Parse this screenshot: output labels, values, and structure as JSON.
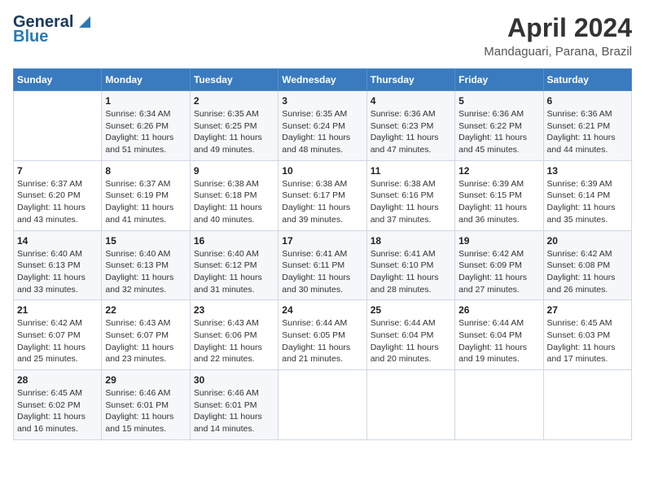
{
  "header": {
    "logo_line1": "General",
    "logo_line2": "Blue",
    "month_title": "April 2024",
    "location": "Mandaguari, Parana, Brazil"
  },
  "calendar": {
    "days_of_week": [
      "Sunday",
      "Monday",
      "Tuesday",
      "Wednesday",
      "Thursday",
      "Friday",
      "Saturday"
    ],
    "weeks": [
      [
        {
          "day": "",
          "info": ""
        },
        {
          "day": "1",
          "info": "Sunrise: 6:34 AM\nSunset: 6:26 PM\nDaylight: 11 hours\nand 51 minutes."
        },
        {
          "day": "2",
          "info": "Sunrise: 6:35 AM\nSunset: 6:25 PM\nDaylight: 11 hours\nand 49 minutes."
        },
        {
          "day": "3",
          "info": "Sunrise: 6:35 AM\nSunset: 6:24 PM\nDaylight: 11 hours\nand 48 minutes."
        },
        {
          "day": "4",
          "info": "Sunrise: 6:36 AM\nSunset: 6:23 PM\nDaylight: 11 hours\nand 47 minutes."
        },
        {
          "day": "5",
          "info": "Sunrise: 6:36 AM\nSunset: 6:22 PM\nDaylight: 11 hours\nand 45 minutes."
        },
        {
          "day": "6",
          "info": "Sunrise: 6:36 AM\nSunset: 6:21 PM\nDaylight: 11 hours\nand 44 minutes."
        }
      ],
      [
        {
          "day": "7",
          "info": "Sunrise: 6:37 AM\nSunset: 6:20 PM\nDaylight: 11 hours\nand 43 minutes."
        },
        {
          "day": "8",
          "info": "Sunrise: 6:37 AM\nSunset: 6:19 PM\nDaylight: 11 hours\nand 41 minutes."
        },
        {
          "day": "9",
          "info": "Sunrise: 6:38 AM\nSunset: 6:18 PM\nDaylight: 11 hours\nand 40 minutes."
        },
        {
          "day": "10",
          "info": "Sunrise: 6:38 AM\nSunset: 6:17 PM\nDaylight: 11 hours\nand 39 minutes."
        },
        {
          "day": "11",
          "info": "Sunrise: 6:38 AM\nSunset: 6:16 PM\nDaylight: 11 hours\nand 37 minutes."
        },
        {
          "day": "12",
          "info": "Sunrise: 6:39 AM\nSunset: 6:15 PM\nDaylight: 11 hours\nand 36 minutes."
        },
        {
          "day": "13",
          "info": "Sunrise: 6:39 AM\nSunset: 6:14 PM\nDaylight: 11 hours\nand 35 minutes."
        }
      ],
      [
        {
          "day": "14",
          "info": "Sunrise: 6:40 AM\nSunset: 6:13 PM\nDaylight: 11 hours\nand 33 minutes."
        },
        {
          "day": "15",
          "info": "Sunrise: 6:40 AM\nSunset: 6:13 PM\nDaylight: 11 hours\nand 32 minutes."
        },
        {
          "day": "16",
          "info": "Sunrise: 6:40 AM\nSunset: 6:12 PM\nDaylight: 11 hours\nand 31 minutes."
        },
        {
          "day": "17",
          "info": "Sunrise: 6:41 AM\nSunset: 6:11 PM\nDaylight: 11 hours\nand 30 minutes."
        },
        {
          "day": "18",
          "info": "Sunrise: 6:41 AM\nSunset: 6:10 PM\nDaylight: 11 hours\nand 28 minutes."
        },
        {
          "day": "19",
          "info": "Sunrise: 6:42 AM\nSunset: 6:09 PM\nDaylight: 11 hours\nand 27 minutes."
        },
        {
          "day": "20",
          "info": "Sunrise: 6:42 AM\nSunset: 6:08 PM\nDaylight: 11 hours\nand 26 minutes."
        }
      ],
      [
        {
          "day": "21",
          "info": "Sunrise: 6:42 AM\nSunset: 6:07 PM\nDaylight: 11 hours\nand 25 minutes."
        },
        {
          "day": "22",
          "info": "Sunrise: 6:43 AM\nSunset: 6:07 PM\nDaylight: 11 hours\nand 23 minutes."
        },
        {
          "day": "23",
          "info": "Sunrise: 6:43 AM\nSunset: 6:06 PM\nDaylight: 11 hours\nand 22 minutes."
        },
        {
          "day": "24",
          "info": "Sunrise: 6:44 AM\nSunset: 6:05 PM\nDaylight: 11 hours\nand 21 minutes."
        },
        {
          "day": "25",
          "info": "Sunrise: 6:44 AM\nSunset: 6:04 PM\nDaylight: 11 hours\nand 20 minutes."
        },
        {
          "day": "26",
          "info": "Sunrise: 6:44 AM\nSunset: 6:04 PM\nDaylight: 11 hours\nand 19 minutes."
        },
        {
          "day": "27",
          "info": "Sunrise: 6:45 AM\nSunset: 6:03 PM\nDaylight: 11 hours\nand 17 minutes."
        }
      ],
      [
        {
          "day": "28",
          "info": "Sunrise: 6:45 AM\nSunset: 6:02 PM\nDaylight: 11 hours\nand 16 minutes."
        },
        {
          "day": "29",
          "info": "Sunrise: 6:46 AM\nSunset: 6:01 PM\nDaylight: 11 hours\nand 15 minutes."
        },
        {
          "day": "30",
          "info": "Sunrise: 6:46 AM\nSunset: 6:01 PM\nDaylight: 11 hours\nand 14 minutes."
        },
        {
          "day": "",
          "info": ""
        },
        {
          "day": "",
          "info": ""
        },
        {
          "day": "",
          "info": ""
        },
        {
          "day": "",
          "info": ""
        }
      ]
    ]
  }
}
